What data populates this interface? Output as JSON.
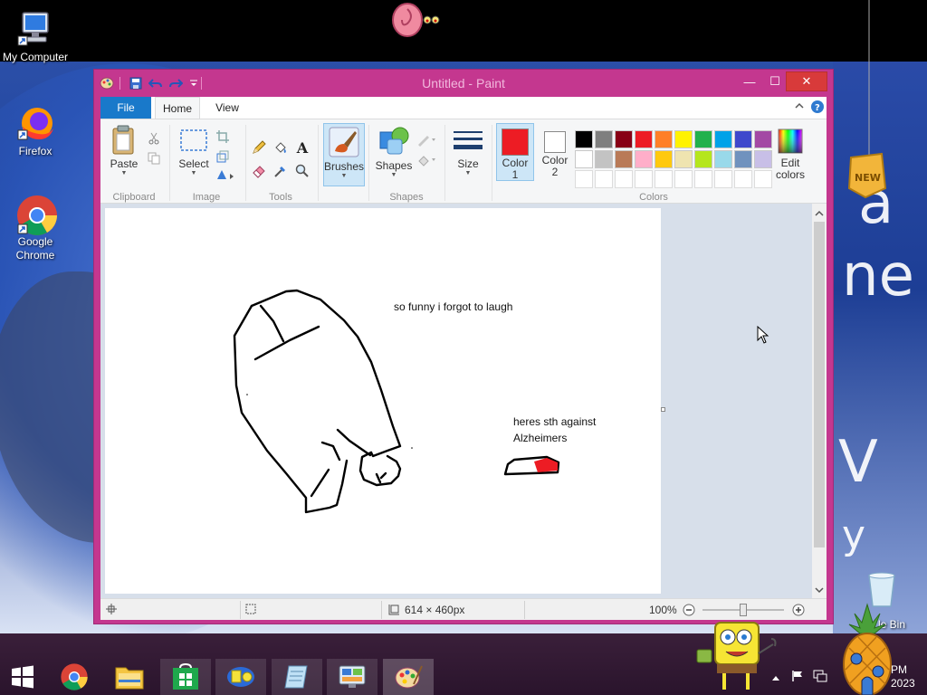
{
  "desktop": {
    "icons": [
      {
        "label": "My Computer"
      },
      {
        "label": "Firefox"
      },
      {
        "label": "Google Chrome"
      },
      {
        "label": "le Bin"
      }
    ],
    "letters": [
      "a",
      "ne",
      "V",
      "y"
    ]
  },
  "window": {
    "title": "Untitled - Paint",
    "controls": {
      "minimize": "—",
      "maximize": "☐",
      "close": "✕"
    }
  },
  "tabs": {
    "file": "File",
    "home": "Home",
    "view": "View"
  },
  "ribbon": {
    "groups": {
      "clipboard": "Clipboard",
      "image": "Image",
      "tools": "Tools",
      "shapes": "Shapes",
      "colors": "Colors"
    },
    "buttons": {
      "paste": "Paste",
      "select": "Select",
      "brushes": "Brushes",
      "shapes": "Shapes",
      "size": "Size",
      "color1": "Color\n1",
      "color1_a": "Color",
      "color1_b": "1",
      "color2_a": "Color",
      "color2_b": "2",
      "edit_colors_a": "Edit",
      "edit_colors_b": "colors"
    },
    "color1": "#ed1c24",
    "color2": "#ffffff",
    "palette_row1": [
      "#000000",
      "#7f7f7f",
      "#880015",
      "#ed1c24",
      "#ff7f27",
      "#fff200",
      "#22b14c",
      "#00a2e8",
      "#3f48cc",
      "#a349a4"
    ],
    "palette_row2": [
      "#ffffff",
      "#c3c3c3",
      "#b97a57",
      "#ffaec9",
      "#ffc90e",
      "#efe4b0",
      "#b5e61d",
      "#99d9ea",
      "#7092be",
      "#c8bfe7"
    ]
  },
  "canvas": {
    "texts": {
      "note1": "so funny i forgot to laugh",
      "note2_line1": "heres sth against",
      "note2_line2": "Alzheimers"
    }
  },
  "status": {
    "image_size": "614 × 460px",
    "zoom": "100%"
  },
  "taskbar": {
    "clock_line1": "PM",
    "clock_line2": "2023"
  }
}
